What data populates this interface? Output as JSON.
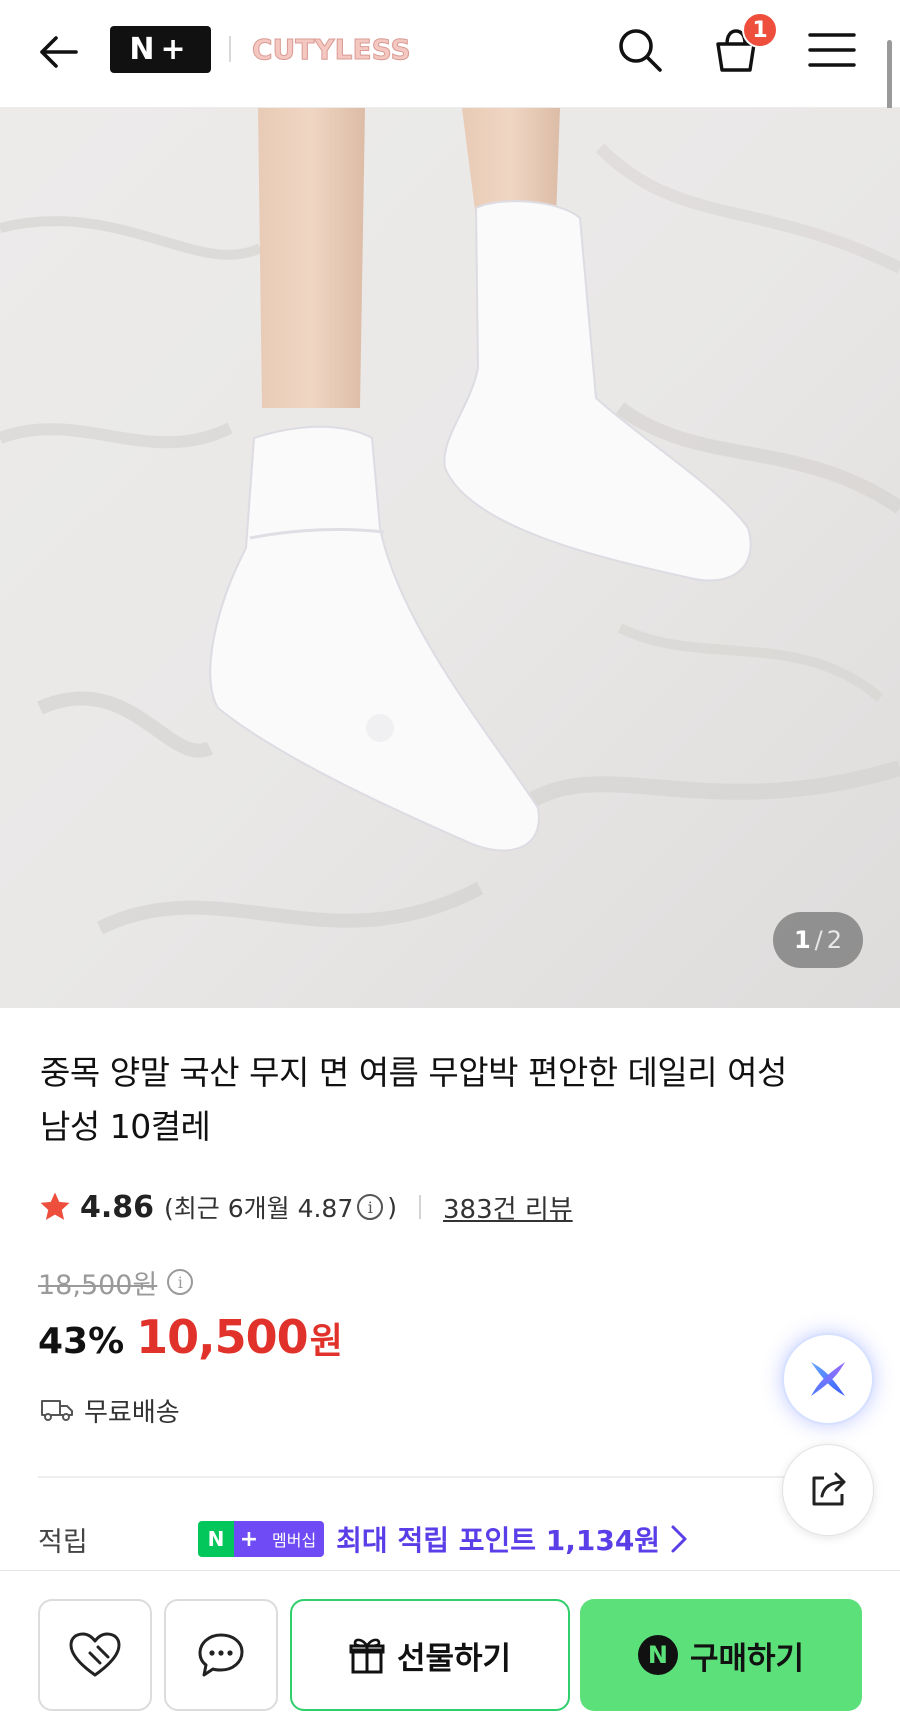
{
  "header": {
    "back_icon": "arrow-left-icon",
    "nplus_logo": "N+",
    "brand": "CUTYLESS",
    "search_icon": "search-icon",
    "cart_icon": "shopping-bag-icon",
    "cart_count": "1",
    "menu_icon": "hamburger-menu-icon"
  },
  "gallery": {
    "current": "1",
    "separator": "/",
    "total": "2"
  },
  "product": {
    "title": "중목 양말 국산 무지 면 여름 무압박 편안한 데일리 여성 남성 10켤레",
    "rating": "4.86",
    "recent_open": "(최근 6개월 4.87",
    "recent_close": ")",
    "reviews": "383건 리뷰",
    "original_price": "18,500원",
    "discount": "43%",
    "price": "10,500",
    "currency": "원",
    "shipping": "무료배송"
  },
  "points": {
    "label": "적립",
    "badge_n": "N",
    "badge_plus": "+",
    "badge_membership": "멤버십",
    "text": "최대 적립 포인트 1,134원"
  },
  "actions": {
    "gift": "선물하기",
    "buy": "구매하기",
    "buy_logo": "N"
  },
  "colors": {
    "price_red": "#e0312b",
    "naver_green": "#03c75a",
    "buy_green": "#5ce07a",
    "membership_purple": "#6e4bf5",
    "star": "#ee4e3c"
  }
}
